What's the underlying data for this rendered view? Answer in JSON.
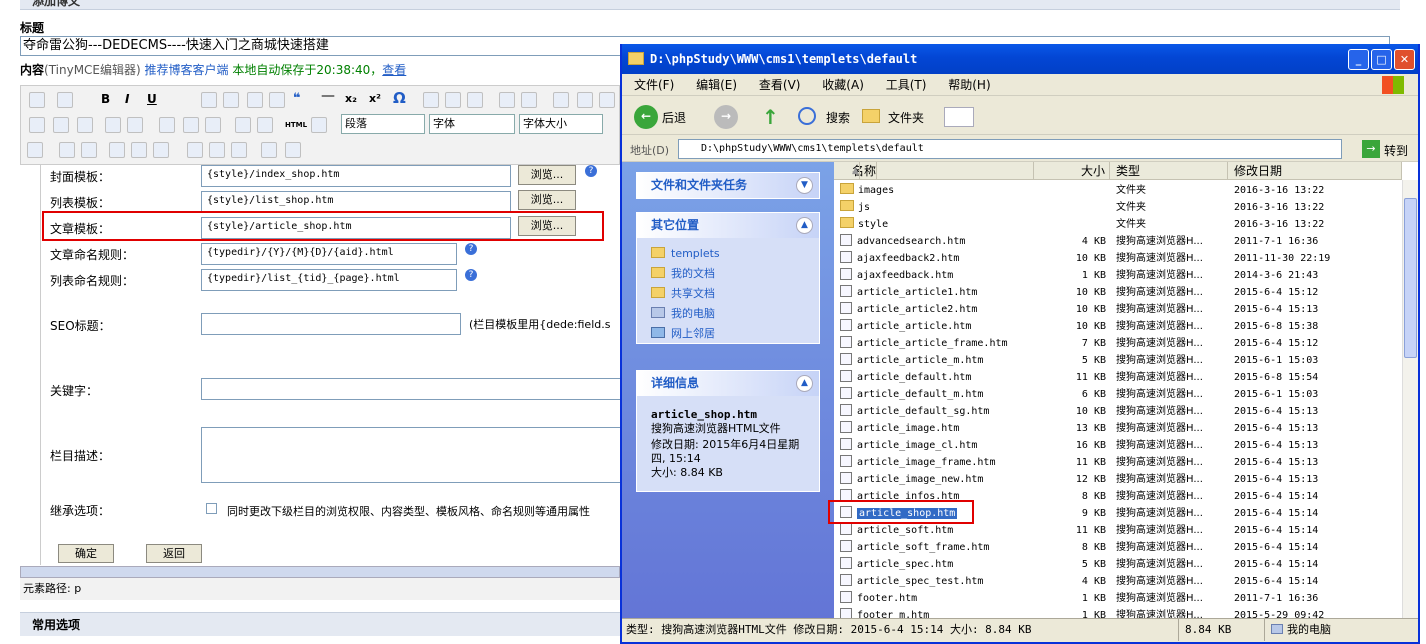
{
  "blog": {
    "section_top": "添加博文",
    "title_label": "标题",
    "title_value": "夺命雷公狗---DEDECMS----快速入门之商城快速搭建",
    "content_label": "内容",
    "editor_name": "(TinyMCE编辑器)",
    "recommend_link": "推荐博客客户端",
    "autosave": "本地自动保存于20:38:40，",
    "view_link": "查看",
    "format_select": "段落",
    "font_select": "字体",
    "size_select": "字体大小",
    "form_rows": [
      {
        "label": "封面模板：",
        "value": "{style}/index_shop.htm",
        "button": "浏览..."
      },
      {
        "label": "列表模板：",
        "value": "{style}/list_shop.htm",
        "button": "浏览..."
      },
      {
        "label": "文章模板：",
        "value": "{style}/article_shop.htm",
        "button": "浏览..."
      },
      {
        "label": "文章命名规则：",
        "value": "{typedir}/{Y}/{M}{D}/{aid}.html"
      },
      {
        "label": "列表命名规则：",
        "value": "{typedir}/list_{tid}_{page}.html"
      }
    ],
    "seo_label": "SEO标题：",
    "seo_note": "(栏目模板里用{dede:field.s",
    "keyword_label": "关键字：",
    "desc_label": "栏目描述：",
    "inherit_label": "继承选项：",
    "inherit_text": "同时更改下级栏目的浏览权限、内容类型、模板风格、命名规则等通用属性",
    "confirm_button": "确定",
    "back_button": "返回",
    "element_path": "元素路径: p",
    "common_options": "常用选项"
  },
  "explorer": {
    "title": "D:\\phpStudy\\WWW\\cms1\\templets\\default",
    "menu": [
      "文件(F)",
      "编辑(E)",
      "查看(V)",
      "收藏(A)",
      "工具(T)",
      "帮助(H)"
    ],
    "toolbar": {
      "back": "后退",
      "search": "搜索",
      "folders": "文件夹"
    },
    "address_label": "地址(D)",
    "address_value": "D:\\phpStudy\\WWW\\cms1\\templets\\default",
    "go_label": "转到",
    "panel_tasks": "文件和文件夹任务",
    "panel_places": "其它位置",
    "places": [
      "templets",
      "我的文档",
      "共享文档",
      "我的电脑",
      "网上邻居"
    ],
    "panel_details": "详细信息",
    "details": {
      "name": "article_shop.htm",
      "type": "搜狗高速浏览器HTML文件",
      "modified": "修改日期: 2015年6月4日星期四, 15:14",
      "size": "大小: 8.84 KB"
    },
    "columns": [
      "名称",
      "大小",
      "类型",
      "修改日期"
    ],
    "files": [
      {
        "name": "images",
        "size": "",
        "type": "文件夹",
        "date": "2016-3-16 13:22",
        "folder": true
      },
      {
        "name": "js",
        "size": "",
        "type": "文件夹",
        "date": "2016-3-16 13:22",
        "folder": true
      },
      {
        "name": "style",
        "size": "",
        "type": "文件夹",
        "date": "2016-3-16 13:22",
        "folder": true
      },
      {
        "name": "advancedsearch.htm",
        "size": "4 KB",
        "type": "搜狗高速浏览器H...",
        "date": "2011-7-1 16:36"
      },
      {
        "name": "ajaxfeedback2.htm",
        "size": "10 KB",
        "type": "搜狗高速浏览器H...",
        "date": "2011-11-30 22:19"
      },
      {
        "name": "ajaxfeedback.htm",
        "size": "1 KB",
        "type": "搜狗高速浏览器H...",
        "date": "2014-3-6 21:43"
      },
      {
        "name": "article_article1.htm",
        "size": "10 KB",
        "type": "搜狗高速浏览器H...",
        "date": "2015-6-4 15:12"
      },
      {
        "name": "article_article2.htm",
        "size": "10 KB",
        "type": "搜狗高速浏览器H...",
        "date": "2015-6-4 15:13"
      },
      {
        "name": "article_article.htm",
        "size": "10 KB",
        "type": "搜狗高速浏览器H...",
        "date": "2015-6-8 15:38"
      },
      {
        "name": "article_article_frame.htm",
        "size": "7 KB",
        "type": "搜狗高速浏览器H...",
        "date": "2015-6-4 15:12"
      },
      {
        "name": "article_article_m.htm",
        "size": "5 KB",
        "type": "搜狗高速浏览器H...",
        "date": "2015-6-1 15:03"
      },
      {
        "name": "article_default.htm",
        "size": "11 KB",
        "type": "搜狗高速浏览器H...",
        "date": "2015-6-8 15:54"
      },
      {
        "name": "article_default_m.htm",
        "size": "6 KB",
        "type": "搜狗高速浏览器H...",
        "date": "2015-6-1 15:03"
      },
      {
        "name": "article_default_sg.htm",
        "size": "10 KB",
        "type": "搜狗高速浏览器H...",
        "date": "2015-6-4 15:13"
      },
      {
        "name": "article_image.htm",
        "size": "13 KB",
        "type": "搜狗高速浏览器H...",
        "date": "2015-6-4 15:13"
      },
      {
        "name": "article_image_cl.htm",
        "size": "16 KB",
        "type": "搜狗高速浏览器H...",
        "date": "2015-6-4 15:13"
      },
      {
        "name": "article_image_frame.htm",
        "size": "11 KB",
        "type": "搜狗高速浏览器H...",
        "date": "2015-6-4 15:13"
      },
      {
        "name": "article_image_new.htm",
        "size": "12 KB",
        "type": "搜狗高速浏览器H...",
        "date": "2015-6-4 15:13"
      },
      {
        "name": "article_infos.htm",
        "size": "8 KB",
        "type": "搜狗高速浏览器H...",
        "date": "2015-6-4 15:14"
      },
      {
        "name": "article_shop.htm",
        "size": "9 KB",
        "type": "搜狗高速浏览器H...",
        "date": "2015-6-4 15:14",
        "selected": true
      },
      {
        "name": "article_soft.htm",
        "size": "11 KB",
        "type": "搜狗高速浏览器H...",
        "date": "2015-6-4 15:14"
      },
      {
        "name": "article_soft_frame.htm",
        "size": "8 KB",
        "type": "搜狗高速浏览器H...",
        "date": "2015-6-4 15:14"
      },
      {
        "name": "article_spec.htm",
        "size": "5 KB",
        "type": "搜狗高速浏览器H...",
        "date": "2015-6-4 15:14"
      },
      {
        "name": "article_spec_test.htm",
        "size": "4 KB",
        "type": "搜狗高速浏览器H...",
        "date": "2015-6-4 15:14"
      },
      {
        "name": "footer.htm",
        "size": "1 KB",
        "type": "搜狗高速浏览器H...",
        "date": "2011-7-1 16:36"
      },
      {
        "name": "footer_m.htm",
        "size": "1 KB",
        "type": "搜狗高速浏览器H...",
        "date": "2015-5-29 09:42"
      }
    ],
    "status_text": "类型: 搜狗高速浏览器HTML文件 修改日期: 2015-6-4 15:14 大小: 8.84 KB",
    "status_size": "8.84 KB",
    "status_location": "我的电脑"
  }
}
